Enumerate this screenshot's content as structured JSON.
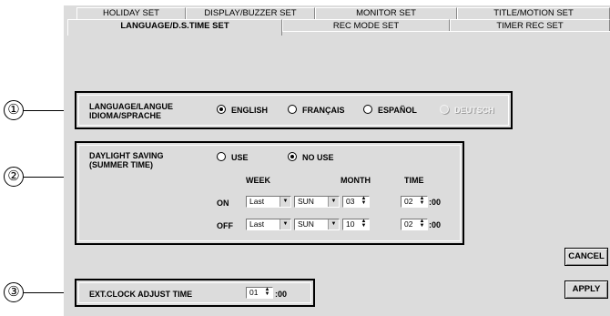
{
  "callouts": [
    "①",
    "②",
    "③"
  ],
  "tabs_back": [
    {
      "label": "HOLIDAY SET"
    },
    {
      "label": "DISPLAY/BUZZER SET"
    },
    {
      "label": "MONITOR SET"
    },
    {
      "label": "TITLE/MOTION SET"
    }
  ],
  "tabs_front": [
    {
      "label": "LANGUAGE/D.S.TIME SET",
      "active": true
    },
    {
      "label": "REC MODE SET"
    },
    {
      "label": "TIMER REC SET"
    }
  ],
  "language": {
    "label_line1": "LANGUAGE/LANGUE",
    "label_line2": "IDIOMA/SPRACHE",
    "options": [
      {
        "label": "ENGLISH",
        "selected": true,
        "enabled": true
      },
      {
        "label": "FRANÇAIS",
        "selected": false,
        "enabled": true
      },
      {
        "label": "ESPAÑOL",
        "selected": false,
        "enabled": true
      },
      {
        "label": "DEUTSCH",
        "selected": false,
        "enabled": false
      }
    ]
  },
  "daylight": {
    "label_line1": "DAYLIGHT SAVING",
    "label_line2": "(SUMMER TIME)",
    "use_label": "USE",
    "no_use_label": "NO USE",
    "selected": "NO USE",
    "headers": {
      "week": "WEEK",
      "month": "MONTH",
      "time": "TIME"
    },
    "rows": [
      {
        "label": "ON",
        "week": "Last",
        "day": "SUN",
        "month": "03",
        "time": "02",
        "time_suffix": ":00"
      },
      {
        "label": "OFF",
        "week": "Last",
        "day": "SUN",
        "month": "10",
        "time": "02",
        "time_suffix": ":00"
      }
    ]
  },
  "ext_clock": {
    "label": "EXT.CLOCK ADJUST TIME",
    "value": "01",
    "suffix": ":00"
  },
  "buttons": {
    "cancel": "CANCEL",
    "apply": "APPLY"
  },
  "icons": {
    "combo_arrow": "triangle-down",
    "spin_arrows": "up-down"
  },
  "colors": {
    "panel": "#dcdcdc",
    "border": "#000000",
    "disabled_text": "#f4f4f4"
  }
}
